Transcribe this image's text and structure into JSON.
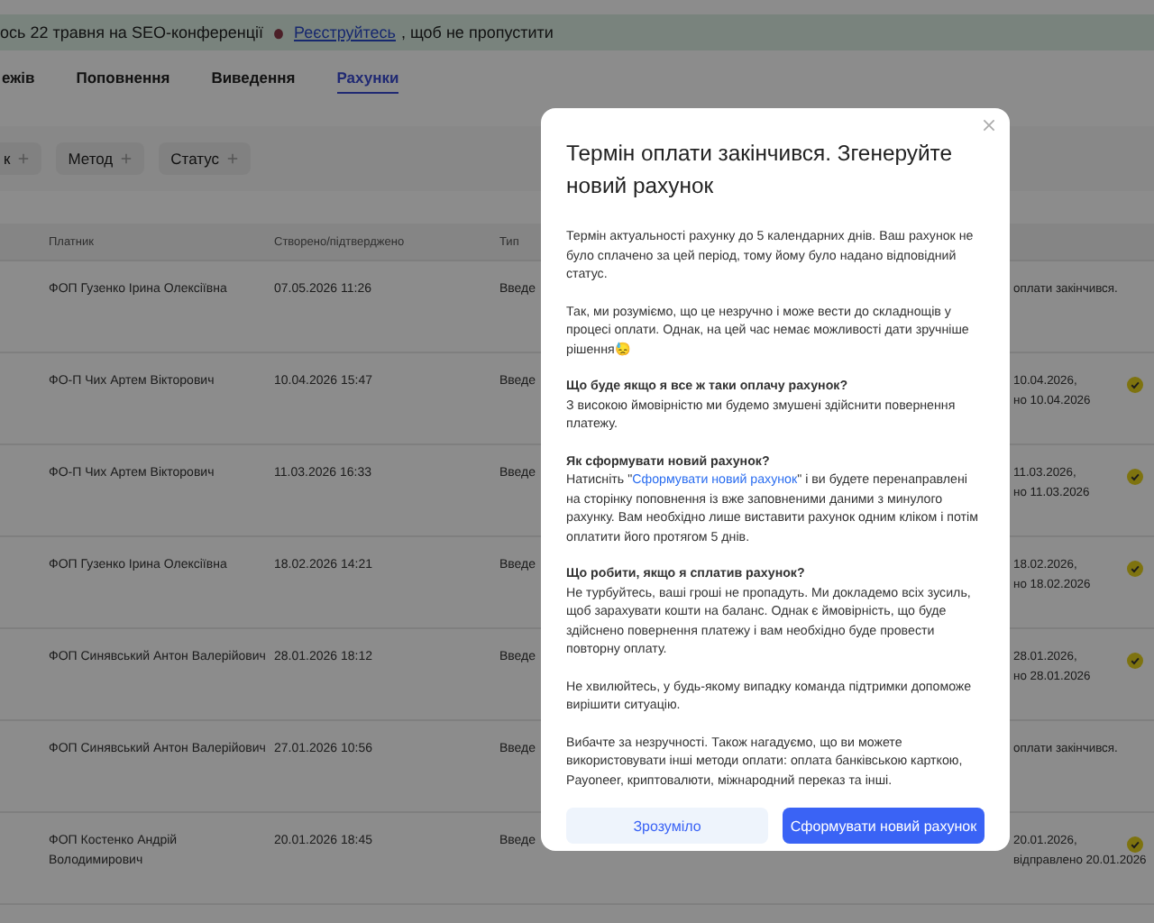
{
  "banner": {
    "text_before": "ось 22 травня на SEO-конференції",
    "link": "Реєструйтесь",
    "text_after": ", щоб не пропустити"
  },
  "tabs": [
    {
      "label": "ежів",
      "selected": false
    },
    {
      "label": "Поповнення",
      "selected": false
    },
    {
      "label": "Виведення",
      "selected": false
    },
    {
      "label": "Рахунки",
      "selected": true
    }
  ],
  "filters": [
    "к",
    "Метод",
    "Статус"
  ],
  "table": {
    "columns": [
      "Платник",
      "Створено/підтверджено",
      "Тип"
    ],
    "rows": [
      {
        "payer": "ФОП Гузенко Ірина Олексіївна",
        "date": "07.05.2026 11:26",
        "type": "Введе",
        "kind": "expired",
        "status": [
          "оплати закінчився."
        ]
      },
      {
        "payer": "ФО-П Чих Артем Вікторович",
        "date": "10.04.2026 15:47",
        "type": "Введе",
        "kind": "paid",
        "status": [
          "10.04.2026,",
          "но 10.04.2026"
        ]
      },
      {
        "payer": "ФО-П Чих Артем Вікторович",
        "date": "11.03.2026 16:33",
        "type": "Введе",
        "kind": "paid",
        "status": [
          "11.03.2026,",
          "но 11.03.2026"
        ]
      },
      {
        "payer": "ФОП Гузенко Ірина Олексіївна",
        "date": "18.02.2026 14:21",
        "type": "Введе",
        "kind": "paid",
        "status": [
          "18.02.2026,",
          "но 18.02.2026"
        ]
      },
      {
        "payer": "ФОП Синявський Антон Валерійович",
        "date": "28.01.2026 18:12",
        "type": "Введе",
        "kind": "paid",
        "status": [
          "28.01.2026,",
          "но 28.01.2026"
        ]
      },
      {
        "payer": "ФОП Синявський Антон Валерійович",
        "date": "27.01.2026 10:56",
        "type": "Введе",
        "kind": "expired",
        "status": [
          "оплати закінчився."
        ]
      },
      {
        "payer": "ФОП Костенко Андрій Володимирович",
        "date": "20.01.2026 18:45",
        "type": "Введе",
        "kind": "paid",
        "status": [
          "20.01.2026,",
          "відправлено 20.01.2026"
        ]
      }
    ]
  },
  "modal": {
    "title": "Термін оплати закінчився. Згенеруйте новий рахунок",
    "sections": [
      {
        "parts": [
          {
            "kind": "text",
            "text": "Термін актуальності рахунку до 5 календарних днів. Ваш рахунок не було сплачено за цей період, тому йому було надано відповідний статус."
          }
        ]
      },
      {
        "parts": [
          {
            "kind": "text",
            "text": "Так, ми розуміємо, що це незручно і може вести до складнощів у процесі оплати. Однак, на цей час немає можливості дати зручніше рішення😓"
          }
        ]
      },
      {
        "heading": "Що буде якщо я все ж таки оплачу рахунок?",
        "parts": [
          {
            "kind": "text",
            "text": "З високою ймовірністю ми будемо змушені здійснити повернення платежу."
          }
        ]
      },
      {
        "heading": "Як сформувати новий рахунок?",
        "parts": [
          {
            "kind": "text",
            "text": "Натисніть \""
          },
          {
            "kind": "link",
            "text": "Сформувати новий рахунок"
          },
          {
            "kind": "text",
            "text": "\" і ви будете перенаправлені на сторінку поповнення із вже заповненими даними з минулого рахунку. Вам необхідно лише виставити рахунок одним кліком і потім оплатити його протягом 5 днів."
          }
        ]
      },
      {
        "heading": "Що робити, якщо я сплатив рахунок?",
        "parts": [
          {
            "kind": "text",
            "text": "Не турбуйтесь, ваші гроші не пропадуть. Ми докладемо всіх зусиль, щоб зарахувати кошти на баланс. Однак є ймовірність, що буде здійснено повернення платежу і вам необхідно буде провести повторну оплату."
          }
        ]
      },
      {
        "parts": [
          {
            "kind": "text",
            "text": "Не хвилюйтесь, у будь-якому випадку команда підтримки допоможе вирішити ситуацію."
          }
        ]
      },
      {
        "parts": [
          {
            "kind": "text",
            "text": "Вибачте за незручності. Також нагадуємо, що ви можете використовувати інші методи оплати: оплата банківською карткою, Payoneer, криптовалюти, міжнародний переказ та інші."
          }
        ]
      }
    ],
    "buttons": [
      {
        "label": "Зрозуміло",
        "kind": "secondary"
      },
      {
        "label": "Сформувати новий рахунок",
        "kind": "primary"
      }
    ]
  }
}
